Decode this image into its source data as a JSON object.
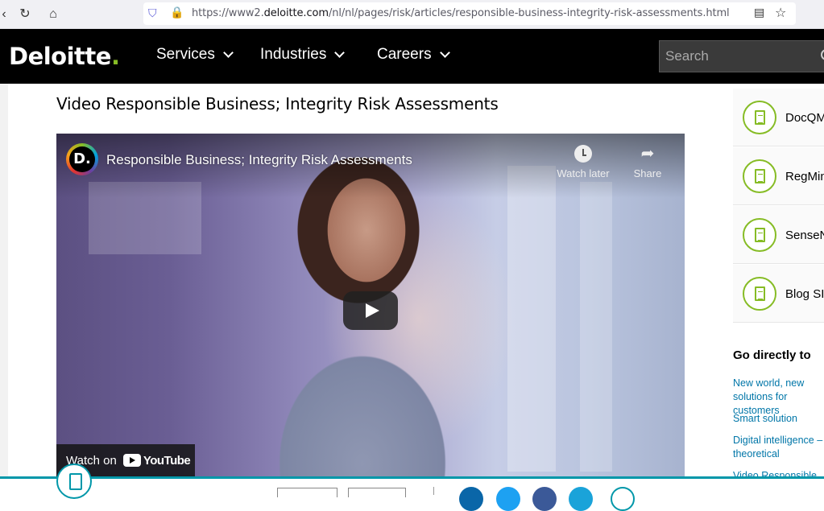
{
  "browser": {
    "url_prefix": "https://www2.",
    "url_domain": "deloitte.com",
    "url_path": "/nl/nl/pages/risk/articles/responsible-business-integrity-risk-assessments.html"
  },
  "nav": {
    "logo_text": "Deloitte",
    "logo_dot": ".",
    "items": [
      "Services",
      "Industries",
      "Careers"
    ],
    "search_placeholder": "Search"
  },
  "main": {
    "title": "Video Responsible Business; Integrity Risk Assessments"
  },
  "video": {
    "channel_letter": "D.",
    "title": "Responsible Business; Integrity Risk Assessments",
    "watch_later": "Watch later",
    "share": "Share",
    "watch_on": "Watch on",
    "youtube": "YouTube"
  },
  "sidebar": {
    "items": [
      "DocQM",
      "RegMin",
      "SenseN",
      "Blog SIF"
    ]
  },
  "go_directly": {
    "heading": "Go directly to",
    "links": [
      "New world, new solutions for customers",
      "Smart solution",
      "Digital intelligence – theoretical",
      "Video Responsible B"
    ]
  },
  "colors": {
    "brand_green": "#86bc25",
    "link_blue": "#0076a8",
    "teal": "#0097a9"
  }
}
